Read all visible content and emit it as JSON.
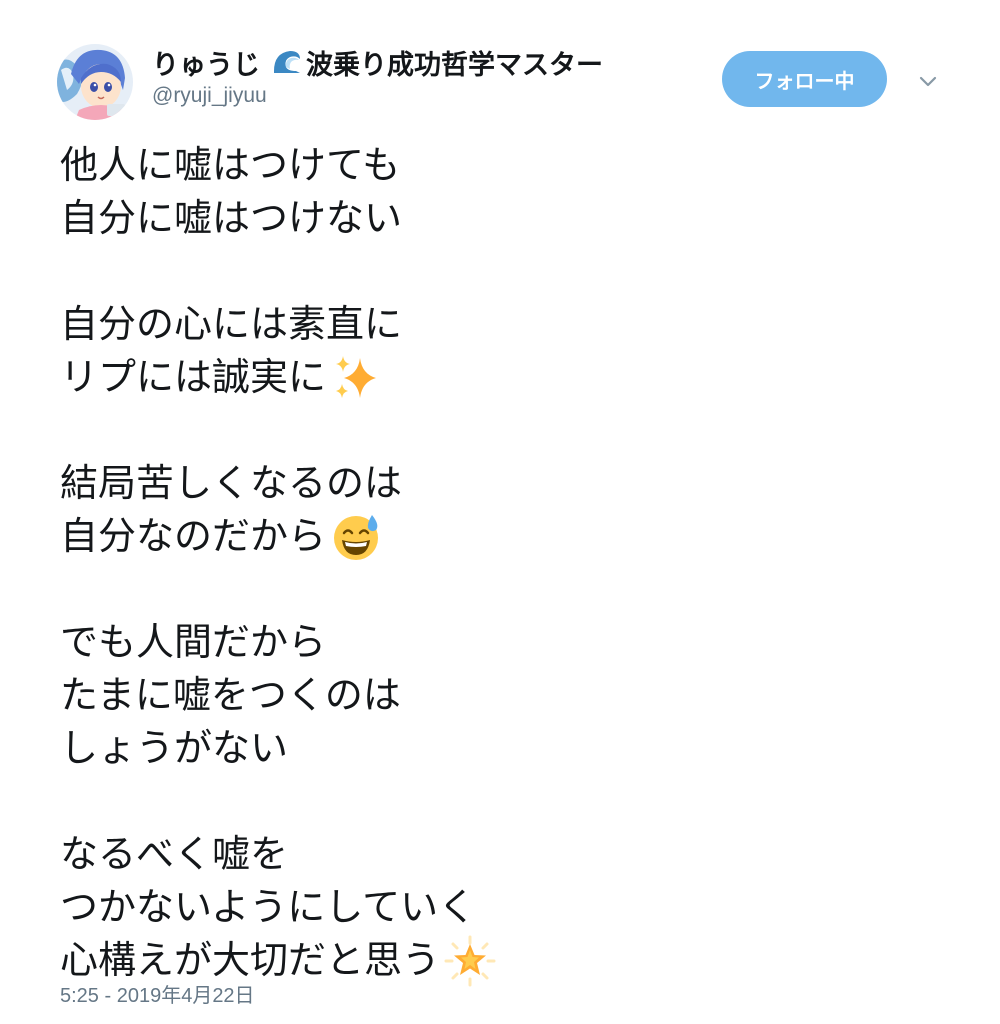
{
  "author": {
    "display_name": "りゅうじ",
    "name_suffix": "波乗り成功哲学マスター",
    "name_icon": "wave-icon",
    "handle": "@ryuji_jiyuu",
    "avatar": "avatar-anime-character"
  },
  "follow_button": {
    "label": "フォロー中",
    "color": "#71b7ed"
  },
  "menu": {
    "icon": "chevron-down-icon"
  },
  "tweet": {
    "lines": {
      "l1": "他人に嘘はつけても",
      "l2": "自分に嘘はつけない",
      "l3": "自分の心には素直に",
      "l4": "リプには誠実に",
      "l5": "結局苦しくなるのは",
      "l6": "自分なのだから",
      "l7": "でも人間だから",
      "l8": "たまに嘘をつくのは",
      "l9": "しょうがない",
      "l10": "なるべく嘘を",
      "l11": "つかないようにしていく",
      "l12": "心構えが大切だと思う"
    },
    "emojis": {
      "sparkles": "sparkles-icon",
      "sweat_smile": "sweat-smile-icon",
      "glowing_star": "glowing-star-icon"
    },
    "timestamp": "5:25 - 2019年4月22日"
  },
  "colors": {
    "text": "#14171a",
    "secondary": "#657786",
    "accent": "#71b7ed"
  }
}
